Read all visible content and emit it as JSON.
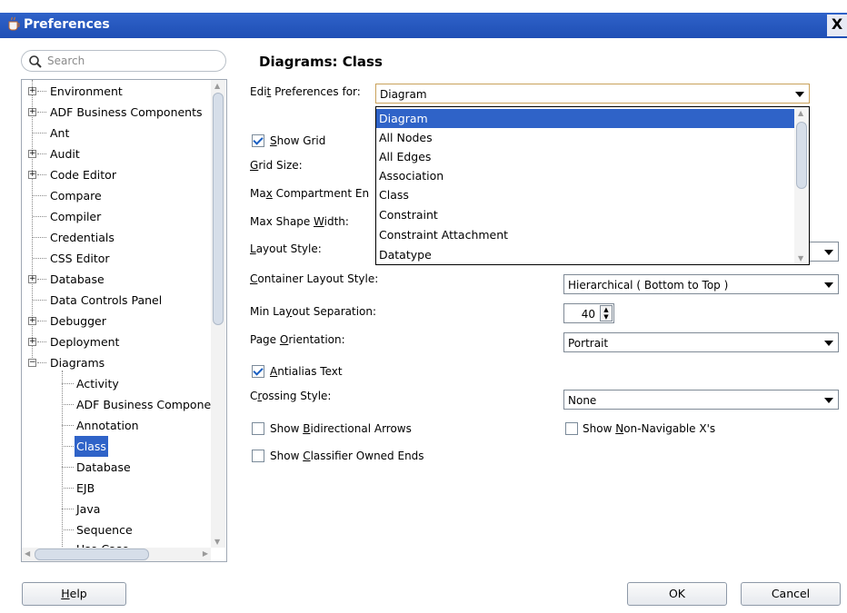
{
  "window": {
    "title": "Preferences",
    "close_glyph": "X"
  },
  "search": {
    "placeholder": "Search"
  },
  "tree": {
    "items": [
      {
        "label": "Environment",
        "expandable": true
      },
      {
        "label": "ADF Business Components",
        "expandable": true
      },
      {
        "label": "Ant",
        "expandable": false
      },
      {
        "label": "Audit",
        "expandable": true
      },
      {
        "label": "Code Editor",
        "expandable": true
      },
      {
        "label": "Compare",
        "expandable": false
      },
      {
        "label": "Compiler",
        "expandable": false
      },
      {
        "label": "Credentials",
        "expandable": false
      },
      {
        "label": "CSS Editor",
        "expandable": false
      },
      {
        "label": "Database",
        "expandable": true
      },
      {
        "label": "Data Controls Panel",
        "expandable": false
      },
      {
        "label": "Debugger",
        "expandable": true
      },
      {
        "label": "Deployment",
        "expandable": true
      },
      {
        "label": "Diagrams",
        "expandable": true,
        "expanded": true
      },
      {
        "label": "Activity",
        "child": true
      },
      {
        "label": "ADF Business Compone",
        "child": true
      },
      {
        "label": "Annotation",
        "child": true
      },
      {
        "label": "Class",
        "child": true,
        "selected": true
      },
      {
        "label": "Database",
        "child": true
      },
      {
        "label": "EJB",
        "child": true
      },
      {
        "label": "Java",
        "child": true
      },
      {
        "label": "Sequence",
        "child": true
      },
      {
        "label": "Use Case",
        "child": true
      }
    ]
  },
  "panel": {
    "title": "Diagrams: Class",
    "edit_for_label_pre": "Edi",
    "edit_for_label_u": "t",
    "edit_for_label_post": " Preferences for:",
    "edit_for_value": "Diagram",
    "show_grid_u": "S",
    "show_grid_post": "how Grid",
    "grid_size_u": "G",
    "grid_size_post": "rid Size:",
    "max_compartment_pre": "Ma",
    "max_compartment_u": "x",
    "max_compartment_post": " Compartment En",
    "max_shape_pre": "Max Shape ",
    "max_shape_u": "W",
    "max_shape_post": "idth:",
    "layout_style_u": "L",
    "layout_style_post": "ayout Style:",
    "container_layout_u": "C",
    "container_layout_post": "ontainer Layout Style:",
    "container_layout_value": "Hierarchical ( Bottom to Top )",
    "min_sep_pre": "Min La",
    "min_sep_u": "y",
    "min_sep_post": "out Separation:",
    "min_sep_value": "40",
    "page_orient_pre": "Page ",
    "page_orient_u": "O",
    "page_orient_post": "rientation:",
    "page_orient_value": "Portrait",
    "antialias_u": "A",
    "antialias_post": "ntialias Text",
    "crossing_pre": "C",
    "crossing_u": "r",
    "crossing_post": "ossing Style:",
    "crossing_value": "None",
    "bidir_pre": "Show ",
    "bidir_u": "B",
    "bidir_post": "idirectional Arrows",
    "nonnav_pre": "Show ",
    "nonnav_u": "N",
    "nonnav_post": "on-Navigable X's",
    "classifier_pre": "Show ",
    "classifier_u": "C",
    "classifier_post": "lassifier Owned Ends"
  },
  "dropdown_options": [
    "Diagram",
    "All Nodes",
    "All Edges",
    "Association",
    "Class",
    "Constraint",
    "Constraint Attachment",
    "Datatype"
  ],
  "buttons": {
    "help_u": "H",
    "help_post": "elp",
    "ok": "OK",
    "cancel": "Cancel"
  },
  "colors": {
    "selection": "#2f63c8",
    "titlebar": "#2357c0"
  }
}
